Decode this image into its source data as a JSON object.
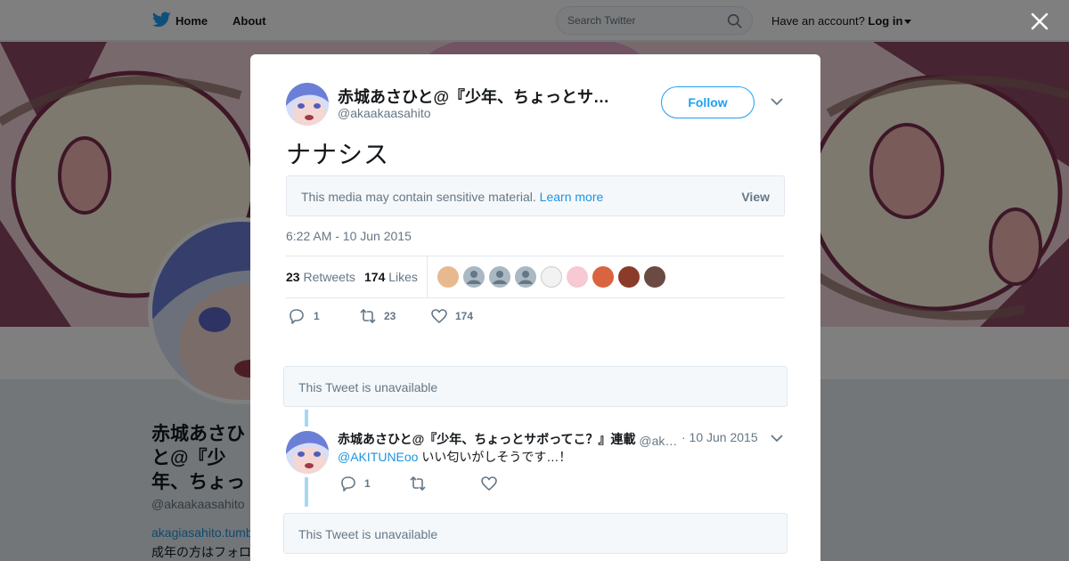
{
  "nav": {
    "home_label": "Home",
    "about_label": "About",
    "search_placeholder": "Search Twitter",
    "have_account": "Have an account?",
    "login_label": "Log in"
  },
  "profile": {
    "name": "赤城あさひと@『少年、ちょっとサボってこ？』連載",
    "handle": "@akaakaasahito",
    "link": "akagiasahito.tumblr.com",
    "bio": "成年の方はフォロー"
  },
  "tweet": {
    "author_name": "赤城あさひと@『少年、ちょっとサボってこ？』連載",
    "author_handle": "@akaakaasahito",
    "follow_label": "Follow",
    "text": "ナナシス",
    "sensitive_text": "This media may contain sensitive material.",
    "learn_more": "Learn more",
    "view_label": "View",
    "timestamp": "6:22 AM - 10 Jun 2015",
    "retweets_count": "23",
    "retweets_label": "Retweets",
    "likes_count": "174",
    "likes_label": "Likes",
    "action_reply_count": "1",
    "action_retweet_count": "23",
    "action_like_count": "174"
  },
  "unavailable_1": "This Tweet is unavailable",
  "unavailable_2": "This Tweet is unavailable",
  "reply": {
    "author_name": "赤城あさひと@『少年、ちょっとサボってこ？』連載",
    "author_handle": "@akaakaasahito",
    "date": "· 10 Jun 2015",
    "mention": "@AKITUNEoo",
    "text": " いい匂いがしそうです…！",
    "reply_count": "1"
  },
  "colors": {
    "twitter_blue": "#1da1f2",
    "link_blue": "#1b95e0",
    "text_secondary": "#657786"
  },
  "icons": [
    "twitter-bird-icon",
    "search-icon",
    "close-icon",
    "chevron-down-icon",
    "reply-icon",
    "retweet-icon",
    "like-icon"
  ]
}
